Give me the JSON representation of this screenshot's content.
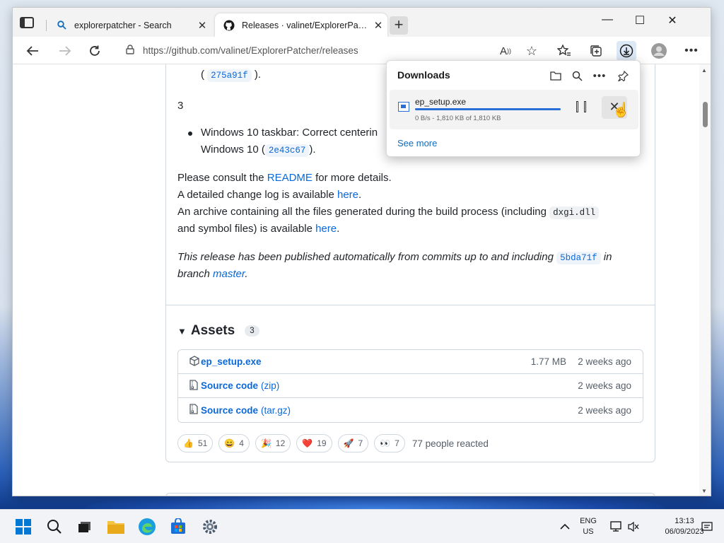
{
  "browser": {
    "tabs": [
      {
        "title": "explorerpatcher - Search",
        "active": false,
        "icon": "search-icon"
      },
      {
        "title": "Releases · valinet/ExplorerPatcher",
        "active": true,
        "icon": "github-icon"
      }
    ],
    "url": "https://github.com/valinet/ExplorerPatcher/releases"
  },
  "release": {
    "commit_275": "275a91f",
    "commit_275_suffix": ").",
    "section_number": "3",
    "bullet_line1": "Windows 10 taskbar: Correct centerin",
    "bullet_line2_prefix": "Windows 10 (",
    "commit_2e4": "2e43c67",
    "bullet_line2_suffix": ").",
    "consult_prefix": "Please consult the ",
    "readme_link": "README",
    "consult_suffix": " for more details.",
    "changelog_prefix": "A detailed change log is available ",
    "here_link": "here",
    "period": ".",
    "archive_prefix": "An archive containing all the files generated during the build process (including ",
    "dxgi": "dxgi.dll",
    "archive_line2_prefix": "and symbol files) is available ",
    "auto_prefix": "This release has been published automatically from commits up to and including ",
    "commit_5bd": "5bda71f",
    "auto_in": " in",
    "branch_prefix": "branch ",
    "master_link": "master",
    "paren_open": "("
  },
  "assets": {
    "title": "Assets",
    "count": "3",
    "rows": [
      {
        "name": "ep_setup.exe",
        "sub": "",
        "size": "1.77 MB",
        "date": "2 weeks ago",
        "icon": "package-icon"
      },
      {
        "name": "Source code",
        "sub": "(zip)",
        "size": "",
        "date": "2 weeks ago",
        "icon": "file-zip-icon"
      },
      {
        "name": "Source code",
        "sub": "(tar.gz)",
        "size": "",
        "date": "2 weeks ago",
        "icon": "file-zip-icon"
      }
    ]
  },
  "reactions": {
    "items": [
      {
        "emoji": "👍",
        "count": "51"
      },
      {
        "emoji": "😄",
        "count": "4"
      },
      {
        "emoji": "🎉",
        "count": "12"
      },
      {
        "emoji": "❤️",
        "count": "19"
      },
      {
        "emoji": "🚀",
        "count": "7"
      },
      {
        "emoji": "👀",
        "count": "7"
      }
    ],
    "summary": "77 people reacted"
  },
  "downloads": {
    "title": "Downloads",
    "file_name": "ep_setup.exe",
    "status": "0 B/s - 1,810 KB of 1,810 KB",
    "progress": 1.0,
    "see_more": "See more"
  },
  "taskbar": {
    "lang_top": "ENG",
    "lang_bottom": "US",
    "time": "13:13",
    "date": "06/09/2023"
  },
  "colors": {
    "accent": "#0969da",
    "edge_blue": "#0f6cbd"
  }
}
